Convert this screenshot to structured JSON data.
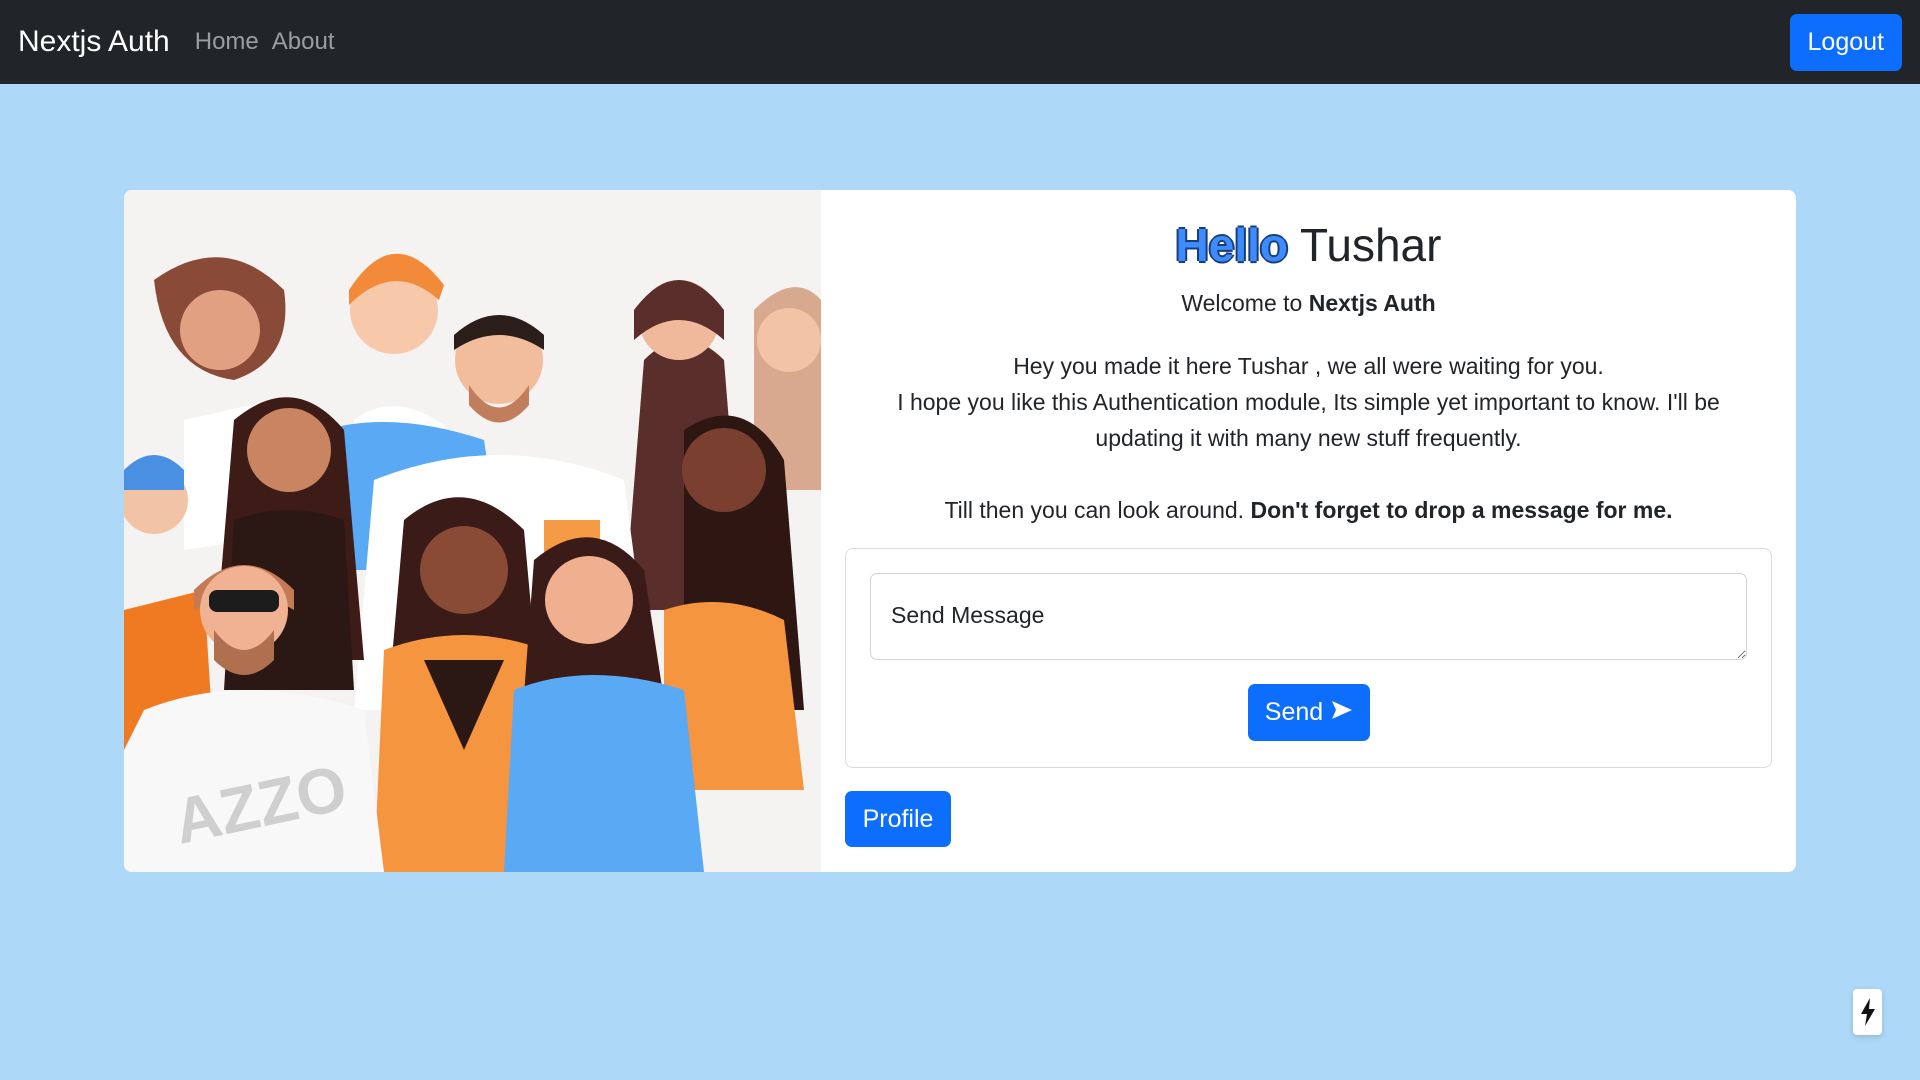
{
  "navbar": {
    "brand": "Nextjs Auth",
    "links": [
      {
        "label": "Home"
      },
      {
        "label": "About"
      }
    ],
    "logout_label": "Logout"
  },
  "main": {
    "greeting_hello": "Hello",
    "greeting_name": "Tushar",
    "welcome_prefix": "Welcome to ",
    "welcome_app": "Nextjs Auth",
    "intro_line1": "Hey you made it here Tushar , we all were waiting for you.",
    "intro_line2": "I hope you like this Authentication module, Its simple yet important to know. I'll be",
    "intro_line3": "updating it with many new stuff frequently.",
    "outro_prefix": "Till then you can look around. ",
    "outro_bold": "Don't forget to drop a message for me.",
    "message_placeholder": "Send Message",
    "send_label": "Send",
    "profile_label": "Profile"
  },
  "illustration": {
    "shirt_text": "AZZO"
  },
  "colors": {
    "page_bg": "#add8f7",
    "navbar_bg": "#212529",
    "primary": "#0d6efd"
  },
  "icons": {
    "send": "send-icon",
    "dev_indicator": "lightning-icon"
  }
}
